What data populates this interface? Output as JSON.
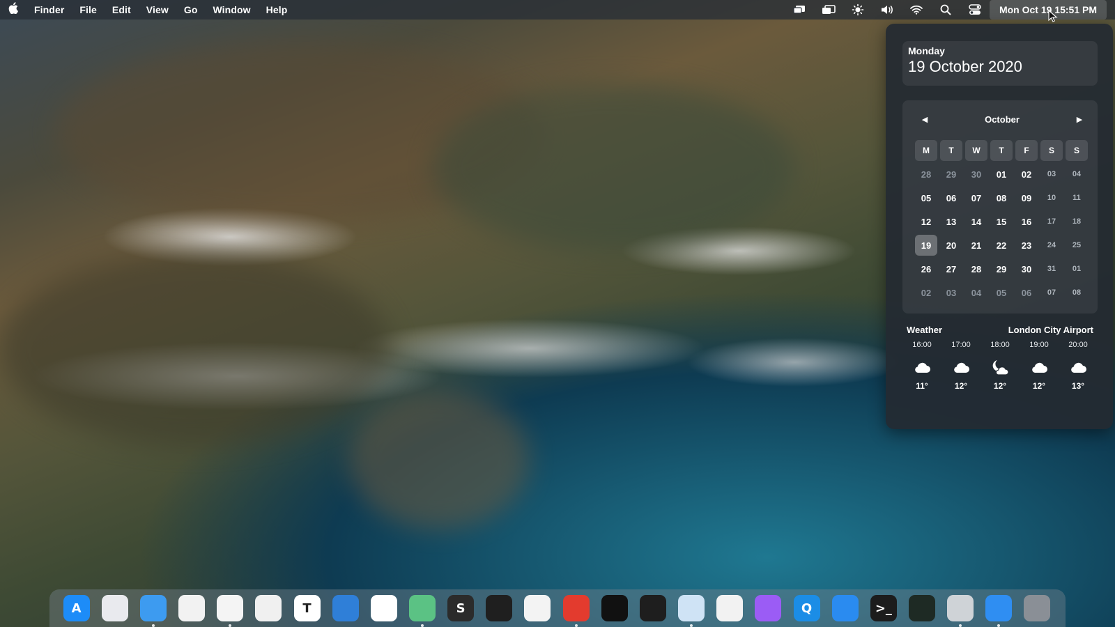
{
  "menubar": {
    "app_name": "Finder",
    "menus": [
      "File",
      "Edit",
      "View",
      "Go",
      "Window",
      "Help"
    ],
    "status_icons": [
      "screen-mirroring-icon",
      "display-icon",
      "brightness-icon",
      "volume-icon",
      "wifi-icon",
      "spotlight-search-icon",
      "control-center-icon"
    ],
    "clock": "Mon Oct 19  15:51 PM"
  },
  "panel": {
    "weekday": "Monday",
    "full_date": "19 October 2020",
    "calendar": {
      "month": "October",
      "weekdays": [
        "M",
        "T",
        "W",
        "T",
        "F",
        "S",
        "S"
      ],
      "weeks": [
        [
          "28",
          "29",
          "30",
          "01",
          "02",
          "03",
          "04"
        ],
        [
          "05",
          "06",
          "07",
          "08",
          "09",
          "10",
          "11"
        ],
        [
          "12",
          "13",
          "14",
          "15",
          "16",
          "17",
          "18"
        ],
        [
          "19",
          "20",
          "21",
          "22",
          "23",
          "24",
          "25"
        ],
        [
          "26",
          "27",
          "28",
          "29",
          "30",
          "31",
          "01"
        ],
        [
          "02",
          "03",
          "04",
          "05",
          "06",
          "07",
          "08"
        ]
      ]
    },
    "weather": {
      "title": "Weather",
      "location": "London City Airport",
      "hours": [
        {
          "time": "16:00",
          "icon": "cloud-icon",
          "temp": "11°"
        },
        {
          "time": "17:00",
          "icon": "cloud-icon",
          "temp": "12°"
        },
        {
          "time": "18:00",
          "icon": "moon-cloud-icon",
          "temp": "12°"
        },
        {
          "time": "19:00",
          "icon": "cloud-icon",
          "temp": "12°"
        },
        {
          "time": "20:00",
          "icon": "cloud-icon",
          "temp": "13°"
        }
      ]
    }
  },
  "dock": {
    "apps": [
      {
        "name": "app-store",
        "glyph": "A",
        "bg": "#1d8cf8",
        "running": false
      },
      {
        "name": "launchpad",
        "glyph": "",
        "bg": "#e9eaee",
        "running": false
      },
      {
        "name": "finder",
        "glyph": "",
        "bg": "#3d9bf0",
        "running": true
      },
      {
        "name": "brave",
        "glyph": "",
        "bg": "#f2f2f2",
        "running": false
      },
      {
        "name": "opera",
        "glyph": "",
        "bg": "#f4f4f4",
        "running": true
      },
      {
        "name": "textedit",
        "glyph": "",
        "bg": "#f0f0f0",
        "running": false
      },
      {
        "name": "typora",
        "glyph": "T",
        "bg": "#ffffff",
        "running": false
      },
      {
        "name": "xcode",
        "glyph": "",
        "bg": "#2f7fd8",
        "running": false
      },
      {
        "name": "vscode",
        "glyph": "",
        "bg": "#ffffff",
        "running": false
      },
      {
        "name": "atom",
        "glyph": "",
        "bg": "#5bc284",
        "running": true
      },
      {
        "name": "sublime-text",
        "glyph": "S",
        "bg": "#2b2b2b",
        "running": false
      },
      {
        "name": "davinci-resolve",
        "glyph": "",
        "bg": "#1f1f1f",
        "running": false
      },
      {
        "name": "chrome",
        "glyph": "",
        "bg": "#f3f3f3",
        "running": false
      },
      {
        "name": "safari",
        "glyph": "",
        "bg": "#e33b2e",
        "running": true
      },
      {
        "name": "github-desktop",
        "glyph": "",
        "bg": "#111111",
        "running": false
      },
      {
        "name": "figma",
        "glyph": "",
        "bg": "#1e1e1e",
        "running": false
      },
      {
        "name": "preview",
        "glyph": "",
        "bg": "#cfe3f5",
        "running": true
      },
      {
        "name": "screenshot",
        "glyph": "",
        "bg": "#f2f2f2",
        "running": false
      },
      {
        "name": "screen-recorder",
        "glyph": "",
        "bg": "#9b5cf5",
        "running": false
      },
      {
        "name": "quicktime",
        "glyph": "Q",
        "bg": "#1b8de6",
        "running": false
      },
      {
        "name": "activity-monitor-wave",
        "glyph": "",
        "bg": "#2a8bf0",
        "running": false
      },
      {
        "name": "terminal",
        "glyph": ">_",
        "bg": "#1c1c1c",
        "running": false
      },
      {
        "name": "activity-monitor",
        "glyph": "",
        "bg": "#1e2a24",
        "running": false
      },
      {
        "name": "system-information",
        "glyph": "",
        "bg": "#cfd3d7",
        "running": true
      },
      {
        "name": "photo-booth",
        "glyph": "",
        "bg": "#2f8ef2",
        "running": true
      },
      {
        "name": "system-preferences",
        "glyph": "",
        "bg": "#8a8f96",
        "running": false
      }
    ]
  }
}
